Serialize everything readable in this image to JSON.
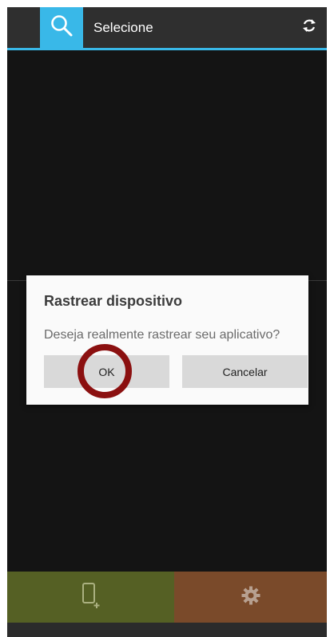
{
  "appbar": {
    "title": "Selecione",
    "search_icon": "search-icon",
    "refresh_icon": "refresh-icon",
    "accent_color": "#39b8e8"
  },
  "dialog": {
    "title": "Rastrear dispositivo",
    "message": "Deseja realmente rastrear seu aplicativo?",
    "ok_label": "OK",
    "cancel_label": "Cancelar"
  },
  "bottom_nav": {
    "add_device_icon": "add-device-icon",
    "settings_icon": "gear-icon",
    "add_color": "#556024",
    "settings_color": "#7a4a2a"
  },
  "highlight": {
    "target": "ok-button",
    "color": "#8b1010"
  }
}
